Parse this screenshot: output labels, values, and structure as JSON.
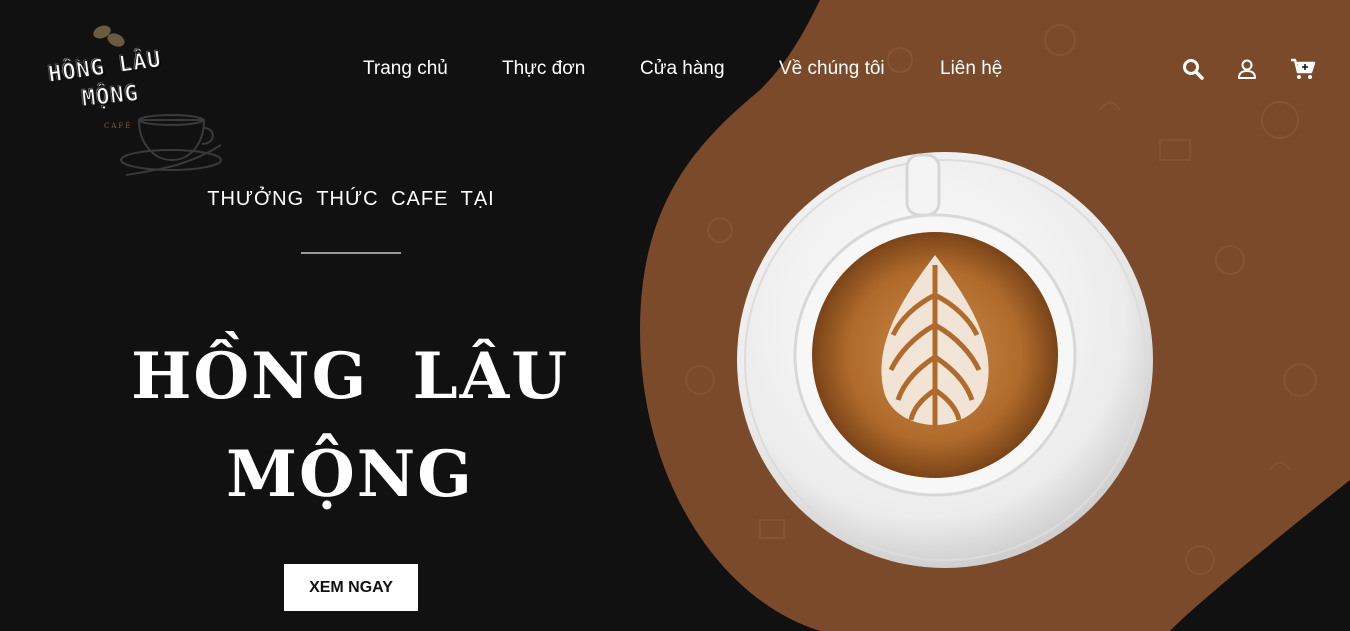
{
  "brand": {
    "logo_line1": "HỒNG LÂU",
    "logo_line2": "MỘNG",
    "logo_sub": "CAFÉ"
  },
  "nav": {
    "items": [
      {
        "label": "Trang chủ"
      },
      {
        "label": "Thực đơn"
      },
      {
        "label": "Cửa hàng"
      },
      {
        "label": "Về chúng tôi"
      },
      {
        "label": "Liên hệ"
      }
    ],
    "icons": [
      "search-icon",
      "user-icon",
      "cart-icon"
    ]
  },
  "hero": {
    "tagline": "THƯỞNG THỨC CAFE TẠI",
    "title_line1": "HỒNG LÂU",
    "title_line2": "MỘNG",
    "cta_label": "XEM NGAY"
  },
  "colors": {
    "background": "#111111",
    "accent_brown": "#7a4a2a",
    "text": "#ffffff",
    "button_bg": "#ffffff",
    "button_text": "#111111"
  }
}
